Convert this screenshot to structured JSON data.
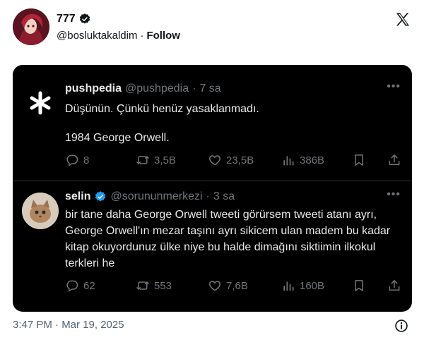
{
  "header": {
    "display_name": "777",
    "handle": "@bosluktakaldim",
    "separator": "·",
    "follow_label": "Follow"
  },
  "quoted_tweet": {
    "name": "pushpedia",
    "handle": "@pushpedia",
    "separator": "·",
    "time": "7 sa",
    "more": "•••",
    "text_line1": "Düşünün. Çünkü henüz yasaklanmadı.",
    "text_line2": "1984 George Orwell.",
    "replies": "8",
    "reposts": "3,5B",
    "likes": "23,5B",
    "views": "386B"
  },
  "reply_tweet": {
    "name": "selin",
    "handle": "@sorununmerkezi",
    "separator": "·",
    "time": "3 sa",
    "more": "•••",
    "text": "bir tane daha George Orwell tweeti görürsem tweeti atanı ayrı, George Orwell'ın mezar taşını ayrı sikicem ulan madem bu kadar kitap okuyordunuz ülke niye bu halde dimağını siktiimin ilkokul terkleri he",
    "replies": "62",
    "reposts": "553",
    "likes": "7,6B",
    "views": "160B"
  },
  "footer": {
    "timestamp": "3:47 PM · Mar 19, 2025"
  },
  "colors": {
    "card_bg": "#000000",
    "primary_text": "#e7e9ea",
    "secondary_text": "#71767b",
    "verified_blue": "#1d9bf0"
  },
  "icons": [
    "verified-badge-icon",
    "x-logo-icon",
    "asterisk-logo-icon",
    "reply-icon",
    "repost-icon",
    "like-icon",
    "views-icon",
    "bookmark-icon",
    "share-icon",
    "info-icon"
  ]
}
